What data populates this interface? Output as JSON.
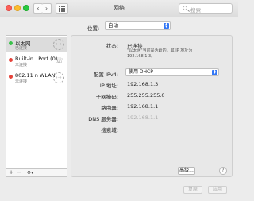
{
  "window": {
    "title": "网络"
  },
  "search": {
    "placeholder": "搜索"
  },
  "location": {
    "label": "位置:",
    "value": "自动"
  },
  "sidebar": {
    "items": [
      {
        "name": "以太网",
        "status": "已连接",
        "status_color": "#39c24a",
        "icon": "network-arrows-icon"
      },
      {
        "name": "Built-in...Port (0)",
        "status": "未连接",
        "status_color": "#e5423a",
        "icon": "phone-icon"
      },
      {
        "name": "802.11 n WLAN",
        "status": "未连接",
        "status_color": "#e5423a",
        "icon": "network-arrows-icon"
      }
    ],
    "add_label": "+",
    "remove_label": "−",
    "action_label": "⚙▾"
  },
  "details": {
    "status_label": "状态:",
    "status_value": "已连接",
    "status_note": "\"以太网\"当前是活跃的，其 IP 地址为 192.168.1.3。",
    "config_label": "配置 IPv4:",
    "config_value": "使用 DHCP",
    "ip_label": "IP 地址:",
    "ip_value": "192.168.1.3",
    "mask_label": "子网掩码:",
    "mask_value": "255.255.255.0",
    "router_label": "路由器:",
    "router_value": "192.168.1.1",
    "dns_label": "DNS 服务器:",
    "dns_value": "192.168.1.1",
    "search_domain_label": "搜索域:",
    "advanced_label": "高级...",
    "help_label": "?"
  },
  "footer": {
    "revert_label": "复原",
    "apply_label": "应用"
  }
}
